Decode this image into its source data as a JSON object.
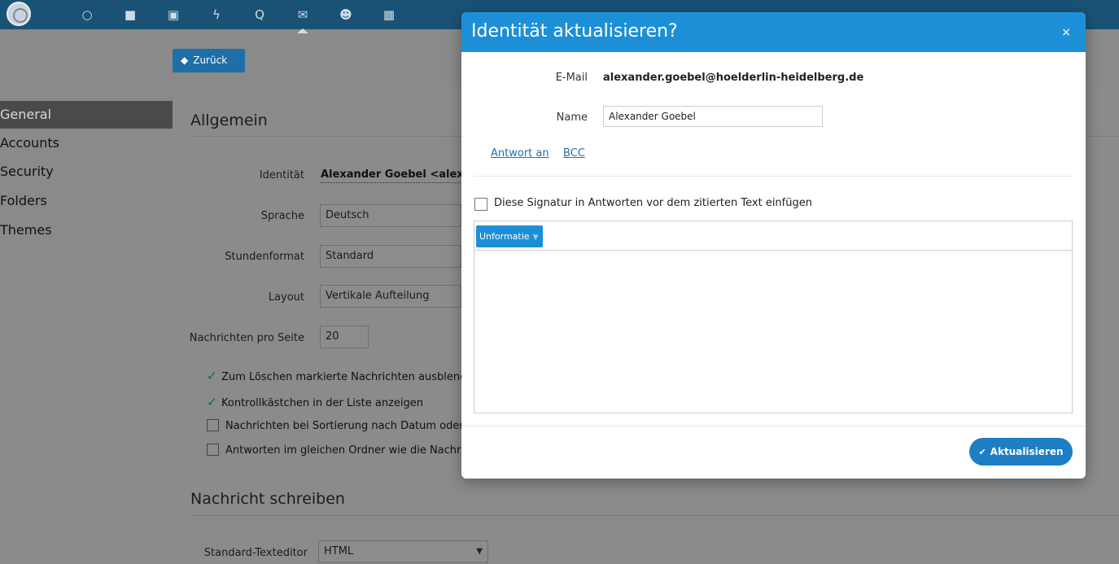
{
  "topbar": {
    "icons": [
      "logo-icon",
      "circle-icon",
      "folder-icon",
      "image-icon",
      "bolt-icon",
      "search-icon",
      "mail-icon",
      "users-icon",
      "calendar-icon"
    ]
  },
  "back_button": {
    "label": "Zurück"
  },
  "sidebar": {
    "items": [
      {
        "label": "General",
        "active": true
      },
      {
        "label": "Accounts"
      },
      {
        "label": "Security"
      },
      {
        "label": "Folders"
      },
      {
        "label": "Themes"
      }
    ]
  },
  "settings": {
    "section_general": "Allgemein",
    "identity_label": "Identität",
    "identity_value": "Alexander Goebel <alexan",
    "language_label": "Sprache",
    "language_value": "Deutsch",
    "time_format_label": "Stundenformat",
    "time_format_value": "Standard",
    "layout_label": "Layout",
    "layout_value": "Vertikale Aufteilung",
    "messages_per_page_label": "Nachrichten pro Seite",
    "messages_per_page_value": "20",
    "checkboxes": [
      {
        "label": "Zum Löschen markierte Nachrichten ausblend",
        "checked": true
      },
      {
        "label": "Kontrollkästchen in der Liste anzeigen",
        "checked": true
      },
      {
        "label": "Nachrichten bei Sortierung nach Datum oder A",
        "checked": false
      },
      {
        "label": "Antworten im gleichen Ordner wie die Nachric",
        "checked": false
      }
    ],
    "section_compose": "Nachricht schreiben",
    "editor_label": "Standard-Texteditor",
    "editor_value": "HTML"
  },
  "modal": {
    "title": "Identität aktualisieren?",
    "close": "×",
    "email_label": "E-Mail",
    "email_value": "alexander.goebel@hoelderlin-heidelberg.de",
    "name_label": "Name",
    "name_value": "Alexander Goebel",
    "link_reply_to": "Antwort an",
    "link_bcc": "BCC",
    "signature_checkbox_label": "Diese Signatur in Antworten vor dem zitierten Text einfügen",
    "signature_checked": false,
    "editor_tag": "Unformatie",
    "update_button": "Aktualisieren"
  }
}
